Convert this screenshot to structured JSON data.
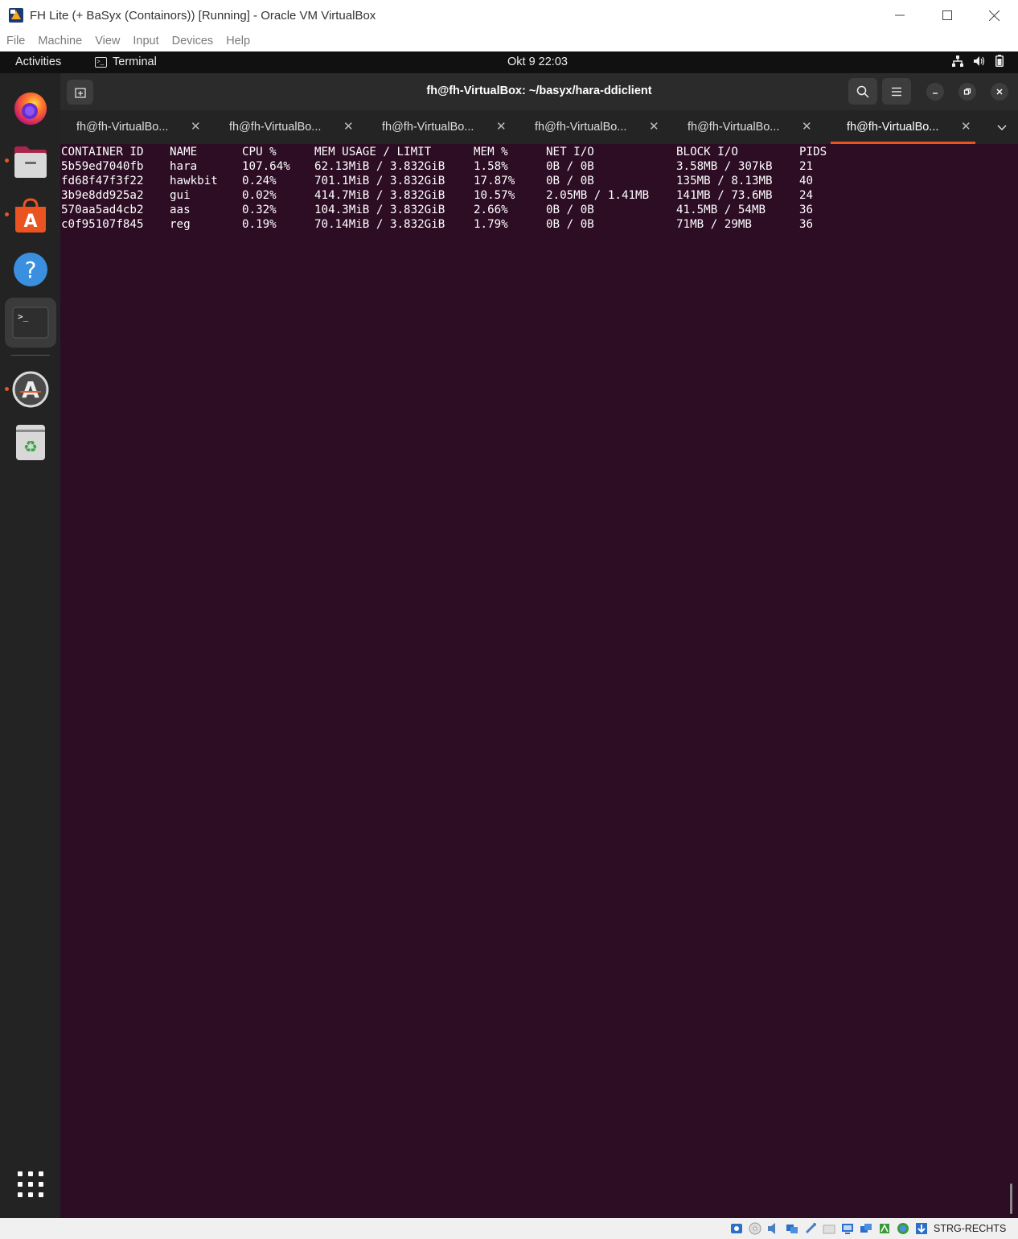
{
  "vbox": {
    "title": "FH Lite (+ BaSyx (Containors)) [Running] - Oracle VM VirtualBox",
    "menu": [
      "File",
      "Machine",
      "View",
      "Input",
      "Devices",
      "Help"
    ],
    "host_key": "STRG-RECHTS"
  },
  "topbar": {
    "activities": "Activities",
    "app_name": "Terminal",
    "clock": "Okt 9  22:03"
  },
  "dock": {
    "items": [
      "firefox-icon",
      "files-icon",
      "software-icon",
      "help-icon",
      "terminal-icon",
      "updater-icon",
      "trash-icon",
      "show-apps-icon"
    ]
  },
  "terminal": {
    "title": "fh@fh-VirtualBox: ~/basyx/hara-ddiclient",
    "tabs": [
      {
        "label": "fh@fh-VirtualBo..."
      },
      {
        "label": "fh@fh-VirtualBo..."
      },
      {
        "label": "fh@fh-VirtualBo..."
      },
      {
        "label": "fh@fh-VirtualBo..."
      },
      {
        "label": "fh@fh-VirtualBo..."
      },
      {
        "label": "fh@fh-VirtualBo..."
      }
    ],
    "active_tab": 5,
    "headers": [
      "CONTAINER ID",
      "NAME",
      "CPU %",
      "MEM USAGE / LIMIT",
      "MEM %",
      "NET I/O",
      "BLOCK I/O",
      "PIDS"
    ],
    "rows": [
      [
        "5b59ed7040fb",
        "hara",
        "107.64%",
        "62.13MiB / 3.832GiB",
        "1.58%",
        "0B / 0B",
        "3.58MB / 307kB",
        "21"
      ],
      [
        "fd68f47f3f22",
        "hawkbit",
        "0.24%",
        "701.1MiB / 3.832GiB",
        "17.87%",
        "0B / 0B",
        "135MB / 8.13MB",
        "40"
      ],
      [
        "3b9e8dd925a2",
        "gui",
        "0.02%",
        "414.7MiB / 3.832GiB",
        "10.57%",
        "2.05MB / 1.41MB",
        "141MB / 73.6MB",
        "24"
      ],
      [
        "570aa5ad4cb2",
        "aas",
        "0.32%",
        "104.3MiB / 3.832GiB",
        "2.66%",
        "0B / 0B",
        "41.5MB / 54MB",
        "36"
      ],
      [
        "c0f95107f845",
        "reg",
        "0.19%",
        "70.14MiB / 3.832GiB",
        "1.79%",
        "0B / 0B",
        "71MB / 29MB",
        "36"
      ]
    ]
  },
  "colors": {
    "terminal_bg": "#2c0d24",
    "accent": "#e95420"
  }
}
